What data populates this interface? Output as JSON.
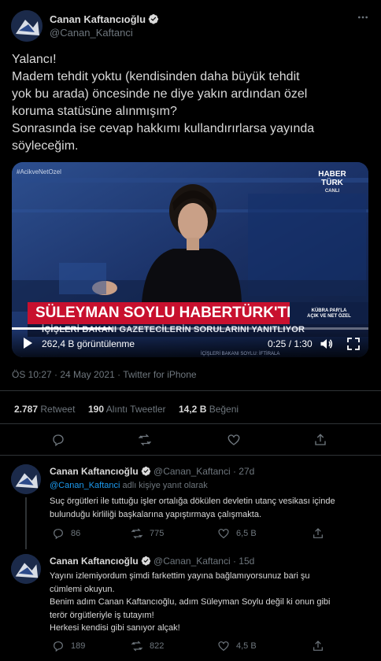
{
  "tweet": {
    "author_name": "Canan Kaftancıoğlu",
    "author_handle": "@Canan_Kaftanci",
    "text_lines": [
      "Yalancı!",
      "Madem tehdit yoktu (kendisinden daha büyük tehdit",
      "yok bu arada) öncesinde ne diye yakın ardından özel",
      "koruma statüsüne alınmışım?",
      "Sonrasında ise cevap hakkımı kullandırırlarsa yayında",
      "söyleceğim."
    ],
    "video": {
      "hashtag": "#AcikveNetOzel",
      "channel_logo_line1": "HABER",
      "channel_logo_line2": "TÜRK",
      "channel_logo_line3": "CANLI",
      "headline": "SÜLEYMAN SOYLU HABERTÜRK'TE",
      "program_tag_line1": "KÜBRA PAR'LA",
      "program_tag_line2": "AÇIK VE NET ÖZEL",
      "subheadline": "İÇİŞLERİ BAKANI GAZETECİLERİN SORULARINI YANITLIYOR",
      "ticker": "İÇİŞLERİ BAKANI SOYLU: İFTİRALA",
      "views": "262,4 B görüntülenme",
      "time": "0:25 / 1:30",
      "progress": 0.28
    },
    "timestamp": "ÖS 10:27 · 24 May 2021 · Twitter for iPhone",
    "stats": {
      "retweets_count": "2.787",
      "retweets_label": "Retweet",
      "quotes_count": "190",
      "quotes_label": "Alıntı Tweetler",
      "likes_count": "14,2 B",
      "likes_label": "Beğeni"
    }
  },
  "replies": [
    {
      "author_name": "Canan Kaftancıoğlu",
      "author_handle": "@Canan_Kaftanci",
      "age": "27d",
      "reply_to_user": "@Canan_Kaftanci",
      "reply_to_suffix": "adlı kişiye yanıt olarak",
      "text_lines": [
        "Suç örgütleri ile tuttuğu işler ortalığa dökülen devletin utanç vesikası içinde",
        "bulunduğu kirliliği başkalarına yapıştırmaya çalışmakta."
      ],
      "replies_count": "86",
      "retweets_count": "775",
      "likes_count": "6,5 B"
    },
    {
      "author_name": "Canan Kaftancıoğlu",
      "author_handle": "@Canan_Kaftanci",
      "age": "15d",
      "text_lines": [
        "Yayını izlemiyordum şimdi farkettim yayına bağlamıyorsunuz bari şu",
        "cümlemi okuyun.",
        "Benim adım Canan Kaftancıoğlu, adım Süleyman Soylu değil ki onun gibi",
        "terör örgütleriyle iş tutayım!",
        "Herkesi kendisi gibi sanıyor alçak!"
      ],
      "replies_count": "189",
      "retweets_count": "822",
      "likes_count": "4,5 B"
    }
  ],
  "colors": {
    "background": "#000000",
    "accent": "#1d9bf0",
    "muted": "#6e767d",
    "divider": "#2f3336",
    "news_red": "#c8102e"
  },
  "icons": [
    "more-icon",
    "verified-icon",
    "play-icon",
    "volume-icon",
    "fullscreen-icon",
    "reply-icon",
    "retweet-icon",
    "like-icon",
    "share-icon"
  ]
}
